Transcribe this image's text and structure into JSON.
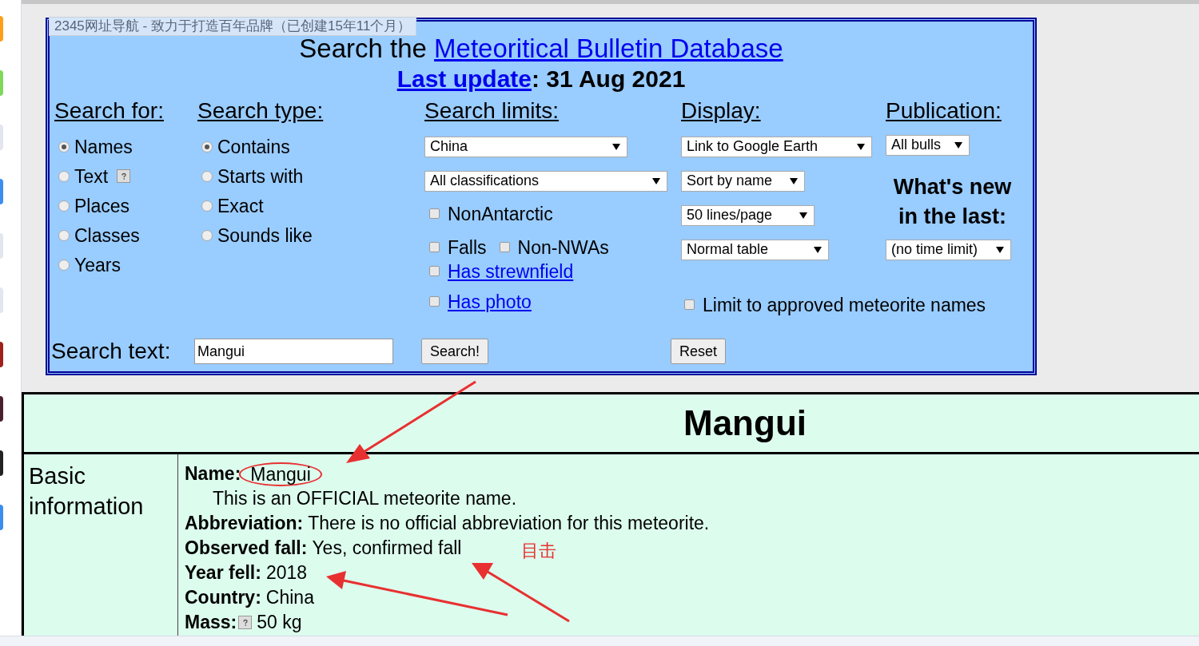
{
  "tooltip": "2345网址导航 - 致力于打造百年品牌（已创建15年11个月）",
  "header": {
    "title_prefix": "Search the",
    "title_link": "Meteoritical Bulletin Database",
    "update_link": "Last update",
    "update_text": ": 31 Aug 2021"
  },
  "search_for": {
    "heading": "Search for:",
    "options": [
      {
        "label": "Names",
        "selected": true,
        "help": false
      },
      {
        "label": "Text",
        "selected": false,
        "help": true
      },
      {
        "label": "Places",
        "selected": false,
        "help": false
      },
      {
        "label": "Classes",
        "selected": false,
        "help": false
      },
      {
        "label": "Years",
        "selected": false,
        "help": false
      }
    ]
  },
  "search_type": {
    "heading": "Search type:",
    "options": [
      {
        "label": "Contains",
        "selected": true
      },
      {
        "label": "Starts with",
        "selected": false
      },
      {
        "label": "Exact",
        "selected": false
      },
      {
        "label": "Sounds like",
        "selected": false
      }
    ]
  },
  "search_limits": {
    "heading": "Search limits:",
    "selects": [
      "China",
      "All classifications"
    ],
    "rows": [
      [
        {
          "label": "NonAntarctic",
          "checked": false,
          "kind": "plain"
        }
      ],
      [
        {
          "label": "Falls",
          "checked": false,
          "kind": "plain"
        },
        {
          "label": "Non-NWAs",
          "checked": false,
          "kind": "plain"
        }
      ],
      [
        {
          "label": "Has strewnfield",
          "checked": false,
          "kind": "link"
        }
      ],
      [
        {
          "label": "Has photo",
          "checked": false,
          "kind": "link"
        }
      ]
    ]
  },
  "display": {
    "heading": "Display:",
    "selects": [
      "Link to Google Earth",
      "Sort by name",
      "50 lines/page",
      "Normal table"
    ],
    "approved": {
      "label": "Limit to approved meteorite names",
      "checked": false
    }
  },
  "publication": {
    "heading": "Publication:",
    "select": "All bulls",
    "whats_new": "What's new in the last:",
    "time_select": "(no time limit)"
  },
  "search_text": {
    "label": "Search text:",
    "value": "Mangui",
    "search_button": "Search!",
    "reset_button": "Reset"
  },
  "result": {
    "title": "Mangui",
    "sections": [
      {
        "label": "Basic information",
        "fields": [
          {
            "label": "Name:",
            "value": "Mangui",
            "note": "This is an OFFICIAL meteorite name.",
            "circled": true,
            "help": false
          },
          {
            "label": "Abbreviation:",
            "value": "There is no official abbreviation for this meteorite.",
            "circled": false,
            "help": false
          },
          {
            "label": "Observed fall:",
            "value": "Yes, confirmed fall",
            "circled": false,
            "help": false
          },
          {
            "label": "Year fell:",
            "value": "2018",
            "circled": false,
            "help": false
          },
          {
            "label": "Country:",
            "value": "China",
            "circled": false,
            "help": false
          },
          {
            "label": "Mass:",
            "value": "50 kg",
            "circled": false,
            "help": true
          }
        ]
      }
    ]
  },
  "annotation": {
    "note": "目击"
  }
}
